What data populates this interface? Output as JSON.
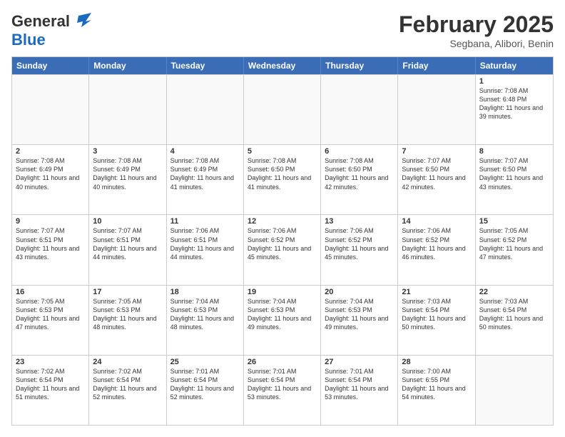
{
  "header": {
    "logo_general": "General",
    "logo_blue": "Blue",
    "month_title": "February 2025",
    "location": "Segbana, Alibori, Benin"
  },
  "weekdays": [
    "Sunday",
    "Monday",
    "Tuesday",
    "Wednesday",
    "Thursday",
    "Friday",
    "Saturday"
  ],
  "weeks": [
    [
      {
        "day": "",
        "info": ""
      },
      {
        "day": "",
        "info": ""
      },
      {
        "day": "",
        "info": ""
      },
      {
        "day": "",
        "info": ""
      },
      {
        "day": "",
        "info": ""
      },
      {
        "day": "",
        "info": ""
      },
      {
        "day": "1",
        "info": "Sunrise: 7:08 AM\nSunset: 6:48 PM\nDaylight: 11 hours and 39 minutes."
      }
    ],
    [
      {
        "day": "2",
        "info": "Sunrise: 7:08 AM\nSunset: 6:49 PM\nDaylight: 11 hours and 40 minutes."
      },
      {
        "day": "3",
        "info": "Sunrise: 7:08 AM\nSunset: 6:49 PM\nDaylight: 11 hours and 40 minutes."
      },
      {
        "day": "4",
        "info": "Sunrise: 7:08 AM\nSunset: 6:49 PM\nDaylight: 11 hours and 41 minutes."
      },
      {
        "day": "5",
        "info": "Sunrise: 7:08 AM\nSunset: 6:50 PM\nDaylight: 11 hours and 41 minutes."
      },
      {
        "day": "6",
        "info": "Sunrise: 7:08 AM\nSunset: 6:50 PM\nDaylight: 11 hours and 42 minutes."
      },
      {
        "day": "7",
        "info": "Sunrise: 7:07 AM\nSunset: 6:50 PM\nDaylight: 11 hours and 42 minutes."
      },
      {
        "day": "8",
        "info": "Sunrise: 7:07 AM\nSunset: 6:50 PM\nDaylight: 11 hours and 43 minutes."
      }
    ],
    [
      {
        "day": "9",
        "info": "Sunrise: 7:07 AM\nSunset: 6:51 PM\nDaylight: 11 hours and 43 minutes."
      },
      {
        "day": "10",
        "info": "Sunrise: 7:07 AM\nSunset: 6:51 PM\nDaylight: 11 hours and 44 minutes."
      },
      {
        "day": "11",
        "info": "Sunrise: 7:06 AM\nSunset: 6:51 PM\nDaylight: 11 hours and 44 minutes."
      },
      {
        "day": "12",
        "info": "Sunrise: 7:06 AM\nSunset: 6:52 PM\nDaylight: 11 hours and 45 minutes."
      },
      {
        "day": "13",
        "info": "Sunrise: 7:06 AM\nSunset: 6:52 PM\nDaylight: 11 hours and 45 minutes."
      },
      {
        "day": "14",
        "info": "Sunrise: 7:06 AM\nSunset: 6:52 PM\nDaylight: 11 hours and 46 minutes."
      },
      {
        "day": "15",
        "info": "Sunrise: 7:05 AM\nSunset: 6:52 PM\nDaylight: 11 hours and 47 minutes."
      }
    ],
    [
      {
        "day": "16",
        "info": "Sunrise: 7:05 AM\nSunset: 6:53 PM\nDaylight: 11 hours and 47 minutes."
      },
      {
        "day": "17",
        "info": "Sunrise: 7:05 AM\nSunset: 6:53 PM\nDaylight: 11 hours and 48 minutes."
      },
      {
        "day": "18",
        "info": "Sunrise: 7:04 AM\nSunset: 6:53 PM\nDaylight: 11 hours and 48 minutes."
      },
      {
        "day": "19",
        "info": "Sunrise: 7:04 AM\nSunset: 6:53 PM\nDaylight: 11 hours and 49 minutes."
      },
      {
        "day": "20",
        "info": "Sunrise: 7:04 AM\nSunset: 6:53 PM\nDaylight: 11 hours and 49 minutes."
      },
      {
        "day": "21",
        "info": "Sunrise: 7:03 AM\nSunset: 6:54 PM\nDaylight: 11 hours and 50 minutes."
      },
      {
        "day": "22",
        "info": "Sunrise: 7:03 AM\nSunset: 6:54 PM\nDaylight: 11 hours and 50 minutes."
      }
    ],
    [
      {
        "day": "23",
        "info": "Sunrise: 7:02 AM\nSunset: 6:54 PM\nDaylight: 11 hours and 51 minutes."
      },
      {
        "day": "24",
        "info": "Sunrise: 7:02 AM\nSunset: 6:54 PM\nDaylight: 11 hours and 52 minutes."
      },
      {
        "day": "25",
        "info": "Sunrise: 7:01 AM\nSunset: 6:54 PM\nDaylight: 11 hours and 52 minutes."
      },
      {
        "day": "26",
        "info": "Sunrise: 7:01 AM\nSunset: 6:54 PM\nDaylight: 11 hours and 53 minutes."
      },
      {
        "day": "27",
        "info": "Sunrise: 7:01 AM\nSunset: 6:54 PM\nDaylight: 11 hours and 53 minutes."
      },
      {
        "day": "28",
        "info": "Sunrise: 7:00 AM\nSunset: 6:55 PM\nDaylight: 11 hours and 54 minutes."
      },
      {
        "day": "",
        "info": ""
      }
    ]
  ]
}
